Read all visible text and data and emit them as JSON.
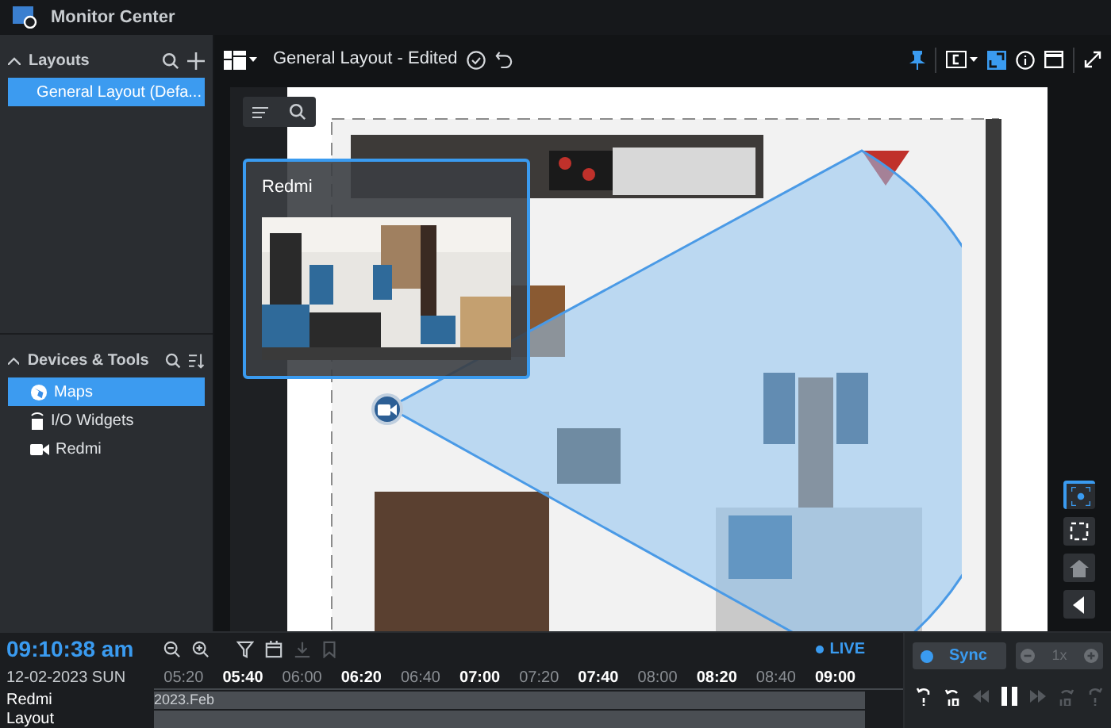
{
  "window": {
    "title": "Monitor Center"
  },
  "sidebar": {
    "sections": [
      {
        "title": "Layouts",
        "expanded": true,
        "items": [
          {
            "label": "General Layout (Defa...",
            "selected": true
          }
        ]
      },
      {
        "title": "Devices & Tools",
        "expanded": true,
        "items": [
          {
            "label": "Maps",
            "selected": true
          },
          {
            "label": "I/O Widgets",
            "selected": false
          },
          {
            "label": "Redmi",
            "selected": false
          }
        ]
      }
    ]
  },
  "toolbar": {
    "title": "General Layout - Edited",
    "pinned": true,
    "fit_selected": true
  },
  "map": {
    "popup": {
      "title": "Redmi"
    }
  },
  "side_controls": [
    {
      "selected": true
    },
    {
      "selected": false
    },
    {
      "selected": false
    },
    {
      "selected": false
    }
  ],
  "timeline": {
    "time": "09:10:38 am",
    "date": "12-02-2023 SUN",
    "live": "LIVE",
    "ticks": [
      {
        "label": "05:20",
        "major": false
      },
      {
        "label": "05:40",
        "major": true
      },
      {
        "label": "06:00",
        "major": false
      },
      {
        "label": "06:20",
        "major": true
      },
      {
        "label": "06:40",
        "major": false
      },
      {
        "label": "07:00",
        "major": true
      },
      {
        "label": "07:20",
        "major": false
      },
      {
        "label": "07:40",
        "major": true
      },
      {
        "label": "08:00",
        "major": false
      },
      {
        "label": "08:20",
        "major": true
      },
      {
        "label": "08:40",
        "major": false
      },
      {
        "label": "09:00",
        "major": true
      }
    ],
    "tracks": [
      {
        "label": "Redmi",
        "recording": "2023.Feb"
      },
      {
        "label": "Layout"
      }
    ]
  },
  "playback": {
    "sync": {
      "label": "Sync",
      "on": true
    },
    "speed": "1x"
  }
}
